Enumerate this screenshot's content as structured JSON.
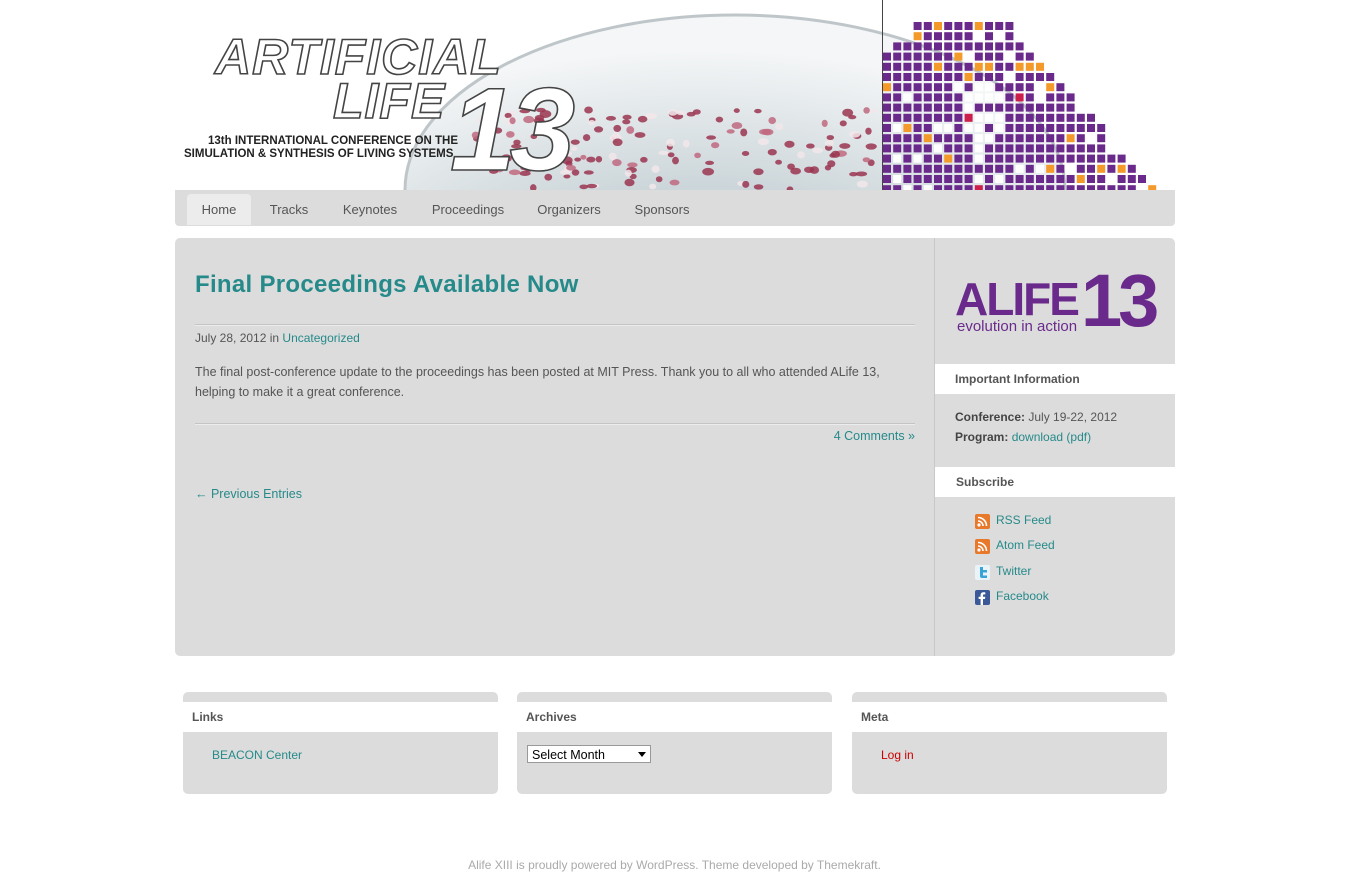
{
  "header": {
    "title_line1": "ARTIFICIAL",
    "title_line2": "LIFE",
    "title_number": "13",
    "subtitle_line1": "13th INTERNATIONAL CONFERENCE ON THE",
    "subtitle_line2": "SIMULATION & SYNTHESIS OF LIVING SYSTEMS"
  },
  "nav": {
    "items": [
      {
        "label": "Home"
      },
      {
        "label": "Tracks"
      },
      {
        "label": "Keynotes"
      },
      {
        "label": "Proceedings"
      },
      {
        "label": "Organizers"
      },
      {
        "label": "Sponsors"
      }
    ],
    "active": "Home"
  },
  "post": {
    "title": "Final Proceedings Available Now",
    "date": "July 28, 2012 in",
    "category": "Uncategorized",
    "body": "The final post-conference update to the proceedings has been posted at MIT Press. Thank you to all who attended ALife 13, helping to make it a great conference.",
    "comments": "4 Comments »",
    "previous": "← Previous Entries"
  },
  "sidebar": {
    "logo_main": "ALIFE",
    "logo_number": "13",
    "logo_tagline": "evolution in action",
    "info_title": "Important Information",
    "conference_label": "Conference:",
    "conference_value": "July 19-22, 2012",
    "program_label": "Program:",
    "program_link": "download (pdf)",
    "subscribe_title": "Subscribe",
    "subscribe": [
      {
        "label": "RSS Feed",
        "icon": "rss-icon"
      },
      {
        "label": "Atom Feed",
        "icon": "rss-icon"
      },
      {
        "label": "Twitter",
        "icon": "twitter-icon"
      },
      {
        "label": "Facebook",
        "icon": "facebook-icon"
      }
    ]
  },
  "widgets": {
    "links_title": "Links",
    "links_item": "BEACON Center",
    "archives_title": "Archives",
    "archives_select": "Select Month",
    "meta_title": "Meta",
    "meta_item": "Log in"
  },
  "footer": {
    "text": "Alife XIII is proudly powered by WordPress. Theme developed by Themekraft."
  },
  "colors": {
    "accent": "#268a8a",
    "purple": "#6a2a8c",
    "login_red": "#cc0000"
  }
}
